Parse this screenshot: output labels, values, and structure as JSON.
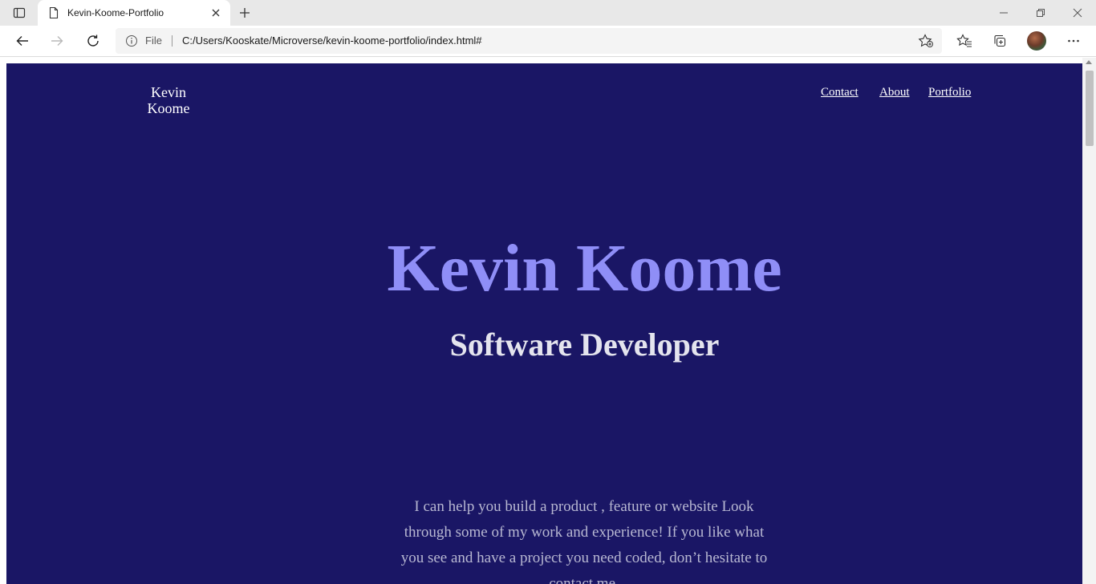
{
  "browser": {
    "tab": {
      "title": "Kevin-Koome-Portfolio",
      "favicon_icon": "document-icon",
      "close_icon": "close-icon"
    },
    "new_tab_icon": "plus-icon",
    "window_controls": [
      "minimize-icon",
      "restore-icon",
      "close-icon"
    ],
    "address_bar": {
      "scheme_label": "File",
      "url": "C:/Users/Kooskate/Microverse/kevin-koome-portfolio/index.html#"
    },
    "toolbar_icons": [
      "back-icon",
      "forward-icon",
      "refresh-icon",
      "add-favorite-icon",
      "favorites-icon",
      "collections-icon",
      "profile-avatar",
      "more-icon"
    ]
  },
  "page": {
    "logo_line1": "Kevin",
    "logo_line2": "Koome",
    "nav": {
      "contact": "Contact",
      "about": "About",
      "portfolio": "Portfolio"
    },
    "hero": {
      "name": "Kevin Koome",
      "role": "Software Developer",
      "description": "I can help you build a product , feature or website Look through some of my work and experience! If you like what you see and have a project you need coded, don’t hesitate to contact me."
    }
  },
  "colors": {
    "page_background": "#1a1665",
    "hero_name": "#8f8ef7",
    "hero_role": "#e4e4ee",
    "hero_text": "#b8b8d2",
    "nav_text": "#ffffff"
  }
}
